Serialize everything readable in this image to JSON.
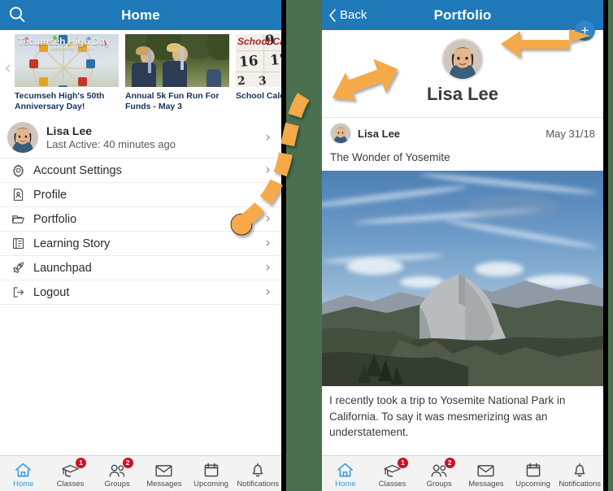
{
  "background_color": "#4a7050",
  "accent_blue": "#1f78b8",
  "badge_red": "#cc1122",
  "annotation_orange": "#f5a94a",
  "left_phone": {
    "header": {
      "title": "Home",
      "search_icon": "search-icon"
    },
    "carousel": {
      "prev_icon": "chevron-left-icon",
      "next_icon": "chevron-right-icon",
      "cards": [
        {
          "overlay_title": "Tecumseh High Day",
          "overlay_sub": "celebrating 50 years",
          "caption": "Tecumseh High's 50th Anniversary Day!"
        },
        {
          "caption": "Annual 5k Fun Run For Funds - May 3"
        },
        {
          "overlay_title": "School Calendar",
          "caption": "School Calenda"
        }
      ]
    },
    "user": {
      "name": "Lisa Lee",
      "status": "Last Active: 40 minutes ago",
      "chevron": "›"
    },
    "menu_items": [
      {
        "label": "Account Settings",
        "icon": "gear-icon",
        "chevron": "›"
      },
      {
        "label": "Profile",
        "icon": "profile-card-icon",
        "chevron": "›"
      },
      {
        "label": "Portfolio",
        "icon": "folder-icon",
        "chevron": "›"
      },
      {
        "label": "Learning Story",
        "icon": "book-icon",
        "chevron": "›"
      },
      {
        "label": "Launchpad",
        "icon": "rocket-icon",
        "chevron": "›"
      },
      {
        "label": "Logout",
        "icon": "logout-icon",
        "chevron": "›"
      }
    ]
  },
  "right_phone": {
    "header": {
      "title": "Portfolio",
      "back_label": "Back",
      "back_icon": "chevron-left-icon"
    },
    "add_button": {
      "icon": "plus-icon",
      "label": "+"
    },
    "profile": {
      "name": "Lisa Lee",
      "avatar": "avatar"
    },
    "post": {
      "author": "Lisa Lee",
      "date": "May 31/18",
      "title": "The Wonder of Yosemite",
      "image_alt": "yosemite-half-dome-photo",
      "body": "I recently took a trip to Yosemite National Park in California. To say it was mesmerizing was an understatement."
    }
  },
  "tabbar": {
    "tabs": [
      {
        "label": "Home",
        "icon": "home-icon",
        "badge": "",
        "active": true
      },
      {
        "label": "Classes",
        "icon": "graduation-cap-icon",
        "badge": "1",
        "active": false
      },
      {
        "label": "Groups",
        "icon": "people-icon",
        "badge": "2",
        "active": false
      },
      {
        "label": "Messages",
        "icon": "envelope-icon",
        "badge": "",
        "active": false
      },
      {
        "label": "Upcoming",
        "icon": "calendar-icon",
        "badge": "",
        "active": false
      },
      {
        "label": "Notifications",
        "icon": "bell-icon",
        "badge": "",
        "active": false
      }
    ]
  },
  "annotations": {
    "dashed_path": "curved-dashed-arrow-from-portfolio-to-portfolio-screen",
    "arrow_into_screen": "arrow-pointing-right",
    "arrow_to_plus": "arrow-pointing-to-add-button"
  }
}
